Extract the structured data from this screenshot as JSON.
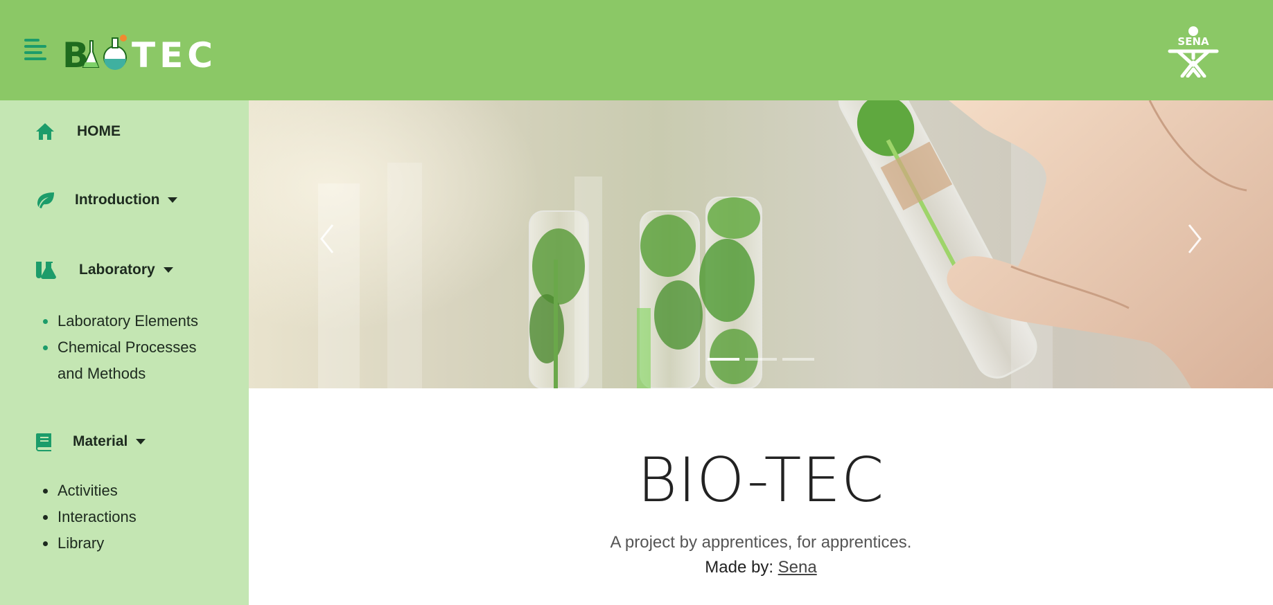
{
  "header": {
    "logo_text": "BIOTEC",
    "brand_logo_text": "SENA",
    "colors": {
      "bar": "#8bc866",
      "icon": "#1c9c6a"
    }
  },
  "sidebar": {
    "home": {
      "label": "HOME",
      "icon": "house-icon"
    },
    "introduction": {
      "label": "Introduction",
      "icon": "leaf-icon"
    },
    "laboratory": {
      "label": "Laboratory",
      "icon": "flask-icon",
      "items": [
        "Laboratory Elements",
        "Chemical Processes",
        "and Methods"
      ]
    },
    "material": {
      "label": "Material",
      "icon": "book-icon",
      "items": [
        "Activities",
        "Interactions",
        "Library"
      ]
    }
  },
  "carousel": {
    "slide_count": 3,
    "active_slide": 1
  },
  "hero": {
    "title": "BIO-TEC",
    "subtitle": "A project by apprentices, for apprentices.",
    "made_by_label": "Made by:",
    "made_by_link": "Sena"
  }
}
